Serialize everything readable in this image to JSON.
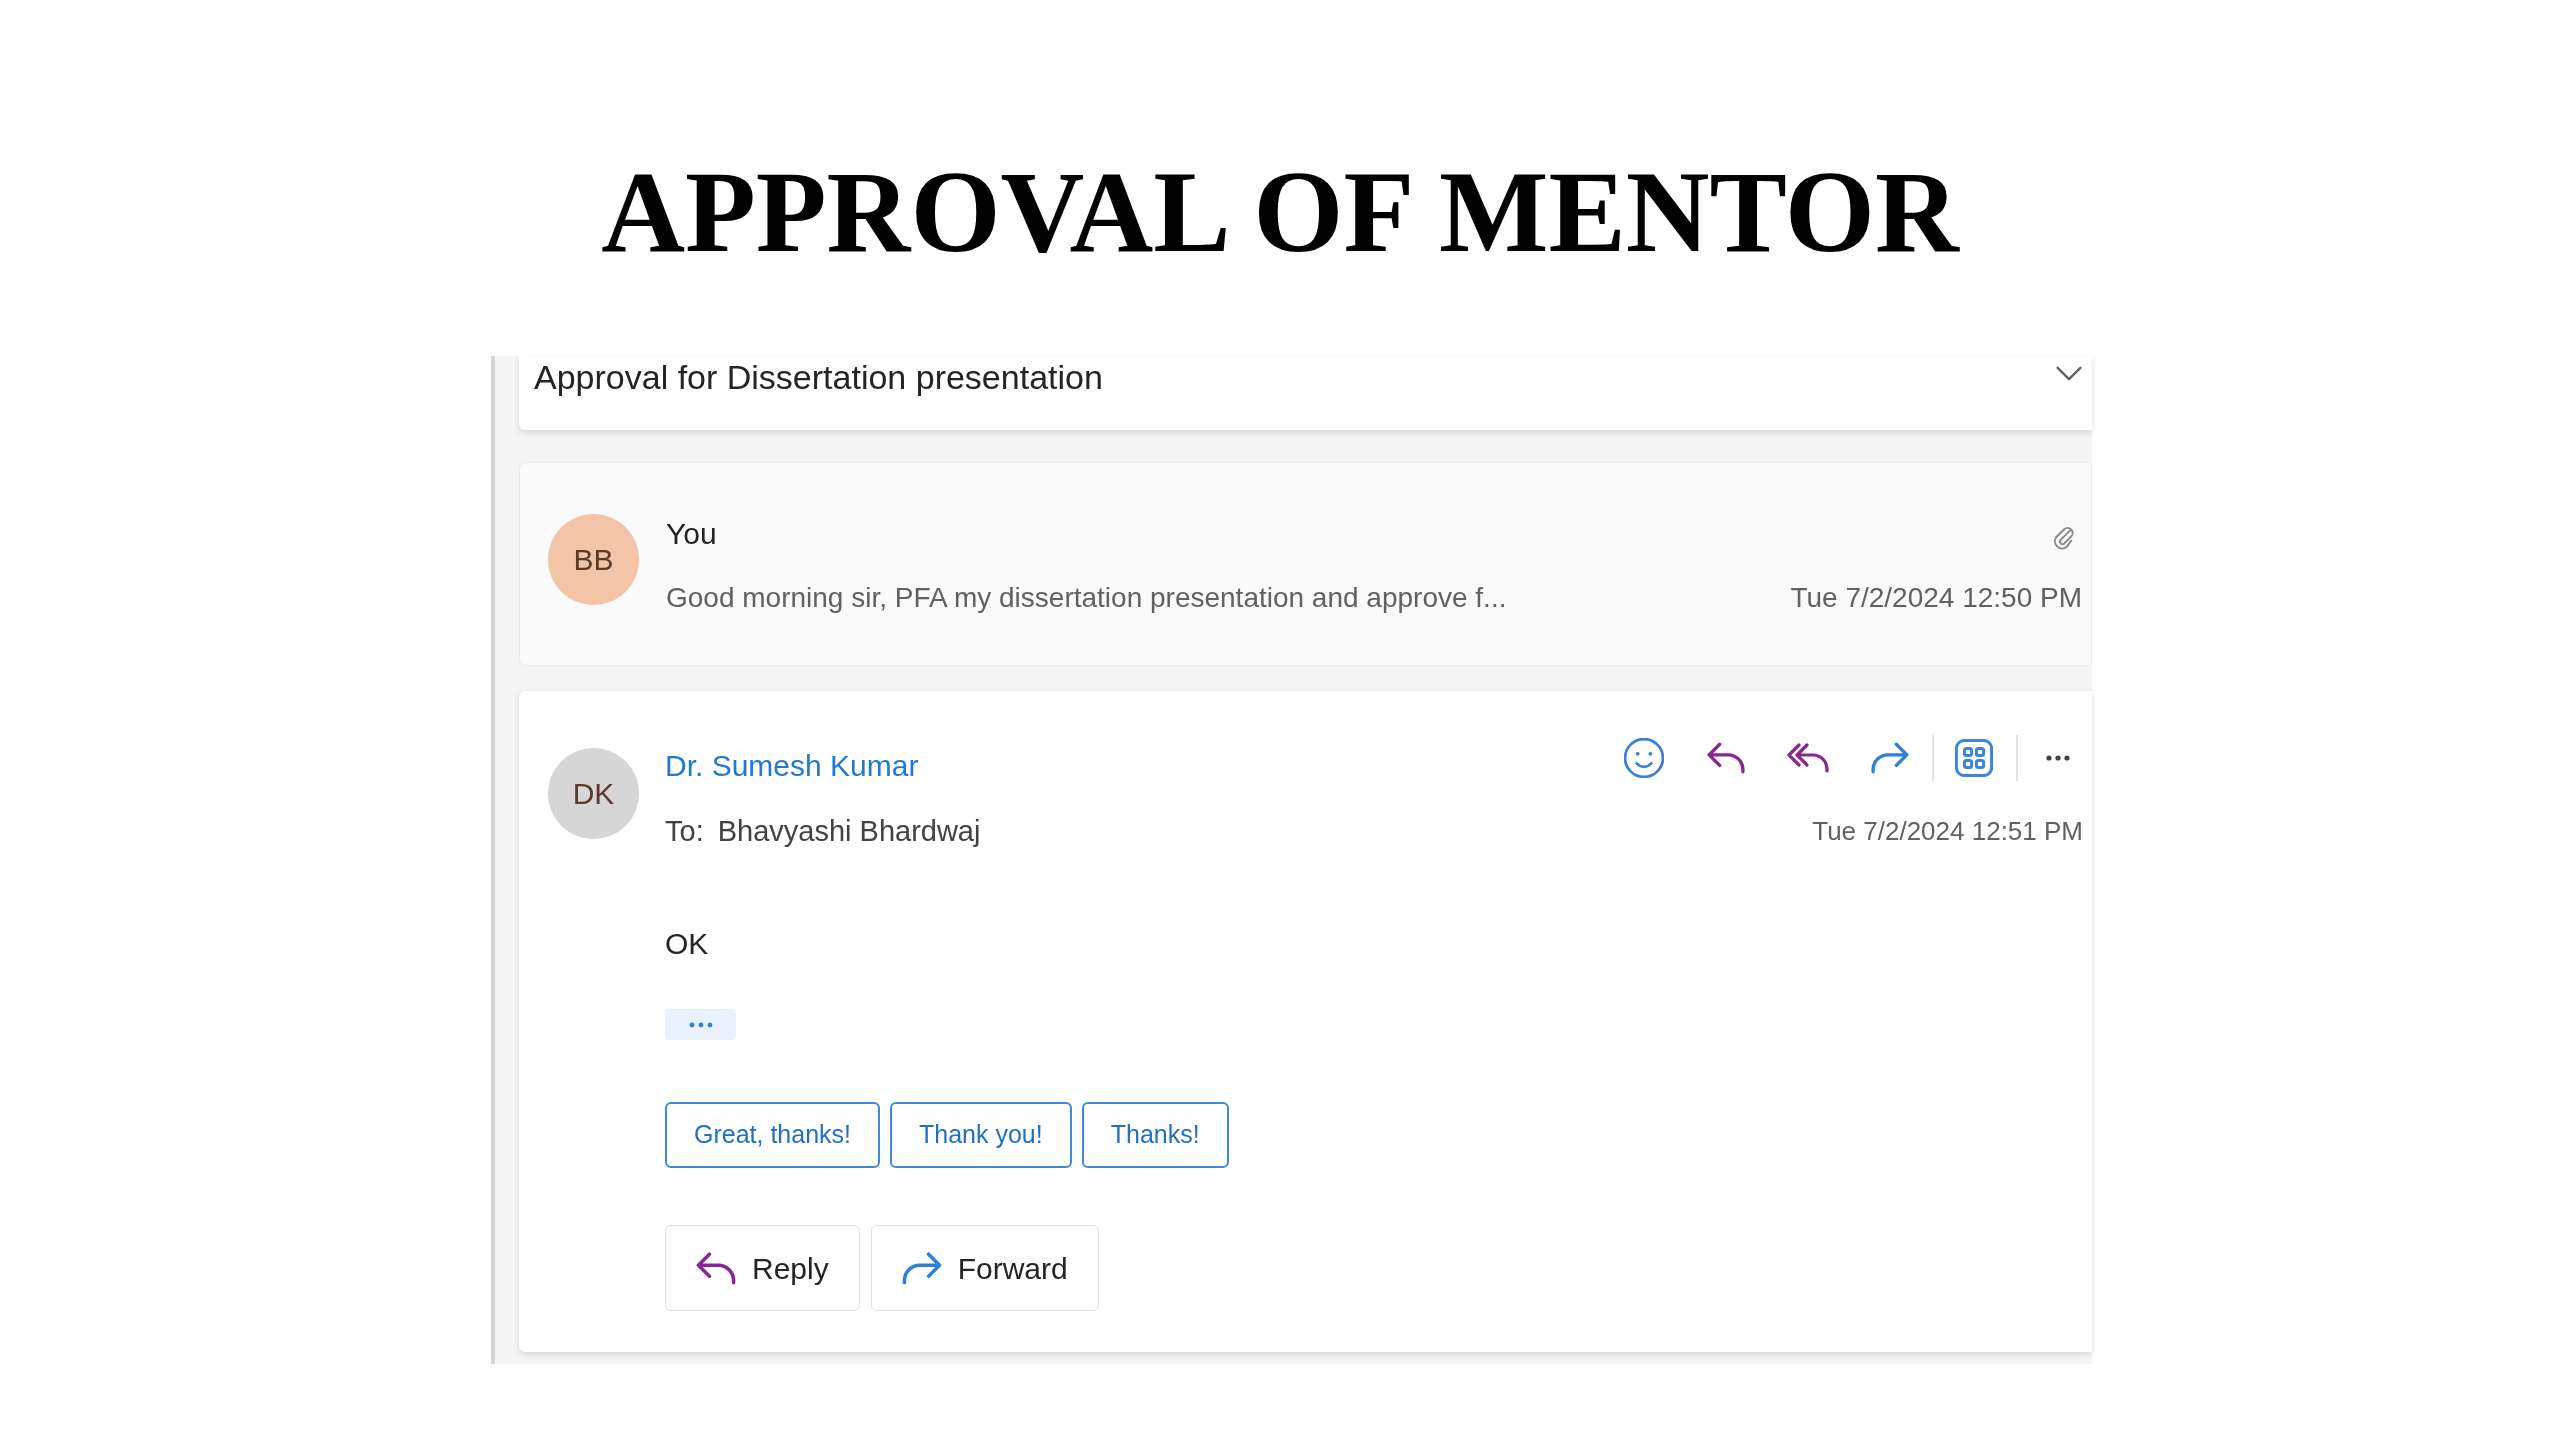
{
  "page_title": "APPROVAL OF MENTOR",
  "thread": {
    "subject": "Approval for Dissertation presentation",
    "messages": [
      {
        "kind": "collapsed",
        "avatar": {
          "initials": "BB",
          "color": "#f3c4a8"
        },
        "sender": "You",
        "has_attachment": true,
        "preview": "Good morning sir, PFA my dissertation presentation and approve f...",
        "date": "Tue 7/2/2024 12:50 PM"
      },
      {
        "kind": "expanded",
        "avatar": {
          "initials": "DK",
          "color": "#d6d6d6"
        },
        "sender": "Dr. Sumesh Kumar",
        "to_label": "To:",
        "recipient": "Bhavyashi Bhardwaj",
        "date": "Tue 7/2/2024 12:51 PM",
        "body": "OK",
        "suggested_replies": [
          "Great, thanks!",
          "Thank you!",
          "Thanks!"
        ],
        "actions": [
          {
            "kind": "reply",
            "label": "Reply"
          },
          {
            "kind": "forward",
            "label": "Forward"
          }
        ]
      }
    ]
  }
}
